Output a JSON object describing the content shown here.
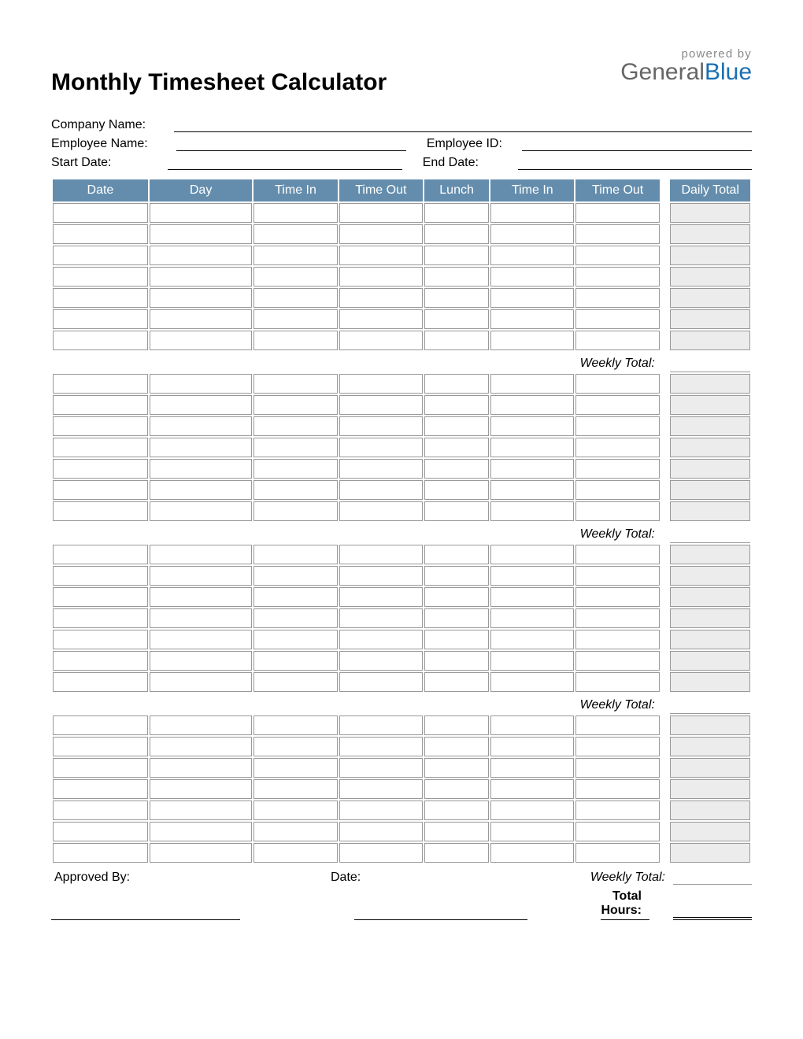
{
  "logo": {
    "powered_text": "powered by",
    "brand_a": "General",
    "brand_b": "Blue"
  },
  "title": "Monthly Timesheet Calculator",
  "meta": {
    "company_label": "Company Name:",
    "employee_label": "Employee Name:",
    "employee_id_label": "Employee ID:",
    "start_label": "Start Date:",
    "end_label": "End Date:"
  },
  "columns": {
    "date": "Date",
    "day": "Day",
    "time_in": "Time In",
    "time_out": "Time Out",
    "lunch": "Lunch",
    "time_in2": "Time In",
    "time_out2": "Time Out",
    "daily_total": "Daily Total"
  },
  "weekly_total_label": "Weekly Total:",
  "footer": {
    "approved_label": "Approved By:",
    "date_label": "Date:",
    "total_hours_label": "Total Hours:"
  },
  "weeks": 4,
  "rows_per_week": 7
}
